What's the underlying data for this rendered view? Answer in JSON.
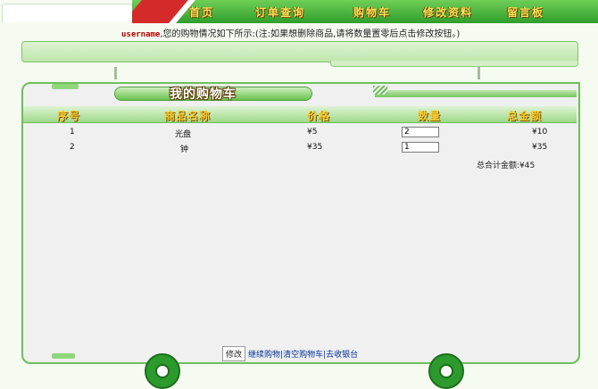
{
  "nav": {
    "items": [
      "首页",
      "订单查询",
      "购物车",
      "修改资料",
      "留言板"
    ]
  },
  "notice": {
    "username": "username",
    "text": ",您的购物情况如下所示:(注:如果想删除商品,请将数量置零后点击修改按钮。)"
  },
  "cart": {
    "title": "我的购物车",
    "columns": [
      "序号",
      "商品名称",
      "价格",
      "数量",
      "总金额"
    ],
    "rows": [
      {
        "index": "1",
        "name": "光盘",
        "price": "¥5",
        "qty": "2",
        "subtotal": "¥10"
      },
      {
        "index": "2",
        "name": "钟",
        "price": "¥35",
        "qty": "1",
        "subtotal": "¥35"
      }
    ],
    "total_label": "总合计金额:",
    "total_value": "¥45"
  },
  "actions": {
    "modify": "修改",
    "continue": "继续购物",
    "clear": "清空购物车",
    "checkout": "去收银台"
  },
  "colors": {
    "nav_green": "#2f9e2c",
    "accent_red": "#d42a2a",
    "title_gold": "#f5cf35",
    "link_blue": "#003399",
    "username_red": "#b40000"
  }
}
